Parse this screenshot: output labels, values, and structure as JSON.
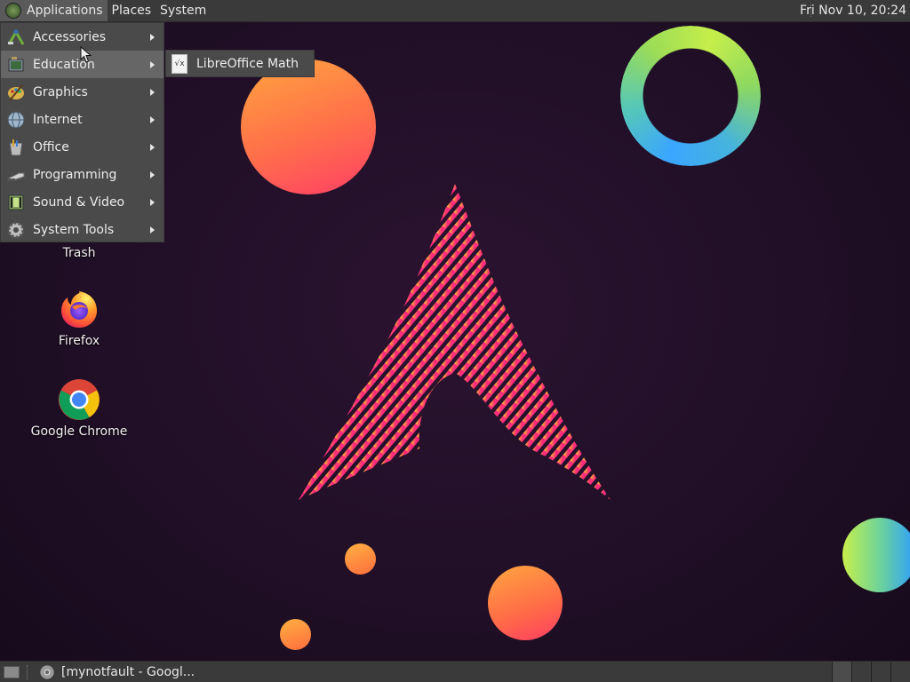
{
  "top_panel": {
    "menus": [
      "Applications",
      "Places",
      "System"
    ],
    "clock": "Fri Nov 10, 20:24"
  },
  "applications_menu": {
    "items": [
      {
        "label": "Accessories",
        "icon": "accessories-icon"
      },
      {
        "label": "Education",
        "icon": "education-icon"
      },
      {
        "label": "Graphics",
        "icon": "graphics-icon"
      },
      {
        "label": "Internet",
        "icon": "internet-icon"
      },
      {
        "label": "Office",
        "icon": "office-icon"
      },
      {
        "label": "Programming",
        "icon": "programming-icon"
      },
      {
        "label": "Sound & Video",
        "icon": "sound-video-icon"
      },
      {
        "label": "System Tools",
        "icon": "system-tools-icon"
      }
    ],
    "active_item": "Education"
  },
  "education_submenu": {
    "items": [
      {
        "label": "LibreOffice Math",
        "icon": "libreoffice-math-icon"
      }
    ]
  },
  "desktop_icons": [
    {
      "label": "Trash",
      "icon": "trash-icon"
    },
    {
      "label": "Firefox",
      "icon": "firefox-icon"
    },
    {
      "label": "Google Chrome",
      "icon": "chrome-icon"
    }
  ],
  "bottom_panel": {
    "taskbar": [
      {
        "label": "[mynotfault - Googl...",
        "icon": "chrome-icon"
      }
    ]
  },
  "colors": {
    "panel": "#3a3a3a",
    "menu": "#4a4a4a",
    "menu_active": "#666666",
    "wallpaper": "#1e0f24"
  }
}
